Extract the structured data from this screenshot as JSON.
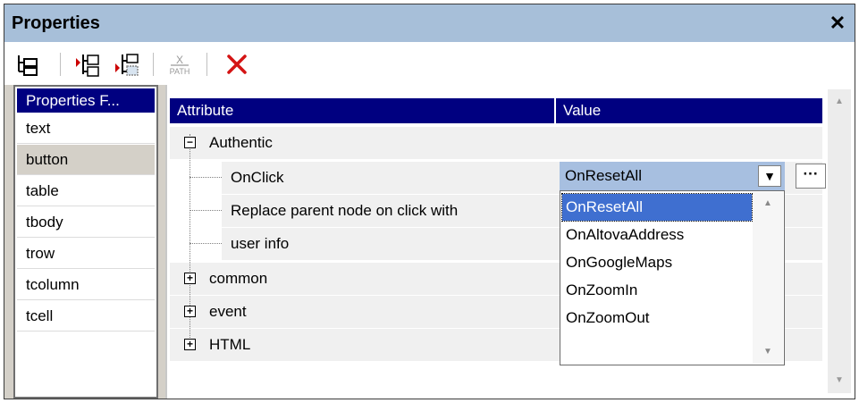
{
  "window": {
    "title": "Properties",
    "close_glyph": "✕"
  },
  "toolbar": {
    "buttons": [
      {
        "name": "tree-view-icon"
      },
      {
        "name": "insert-before-icon"
      },
      {
        "name": "insert-after-icon"
      },
      {
        "name": "xpath-icon",
        "label_top": "X",
        "label_bottom": "PATH"
      },
      {
        "name": "delete-icon",
        "glyph": "✕",
        "color": "#d41414"
      }
    ]
  },
  "left_panel": {
    "header": "Properties F...",
    "items": [
      "text",
      "button",
      "table",
      "tbody",
      "trow",
      "tcolumn",
      "tcell"
    ],
    "selected": "button"
  },
  "grid": {
    "col_attribute": "Attribute",
    "col_value": "Value",
    "groups": [
      {
        "label": "Authentic",
        "expander": "−"
      },
      {
        "label": "common",
        "expander": "+"
      },
      {
        "label": "event",
        "expander": "+"
      },
      {
        "label": "HTML",
        "expander": "+"
      }
    ],
    "authentic_children": [
      "OnClick",
      "Replace parent node on click with",
      "user info"
    ]
  },
  "combo": {
    "value": "OnResetAll",
    "arrow": "▼",
    "dots": "···"
  },
  "dropdown": {
    "options": [
      "OnResetAll",
      "OnAltovaAddress",
      "OnGoogleMaps",
      "OnZoomIn",
      "OnZoomOut"
    ],
    "selected": "OnResetAll",
    "scroll_up": "▲",
    "scroll_down": "▼"
  },
  "scrollbar": {
    "up": "▲",
    "down": "▼"
  },
  "colors": {
    "header_bg": "#000080",
    "title_bg": "#a7bfd9",
    "selection": "#3f6fd0"
  }
}
